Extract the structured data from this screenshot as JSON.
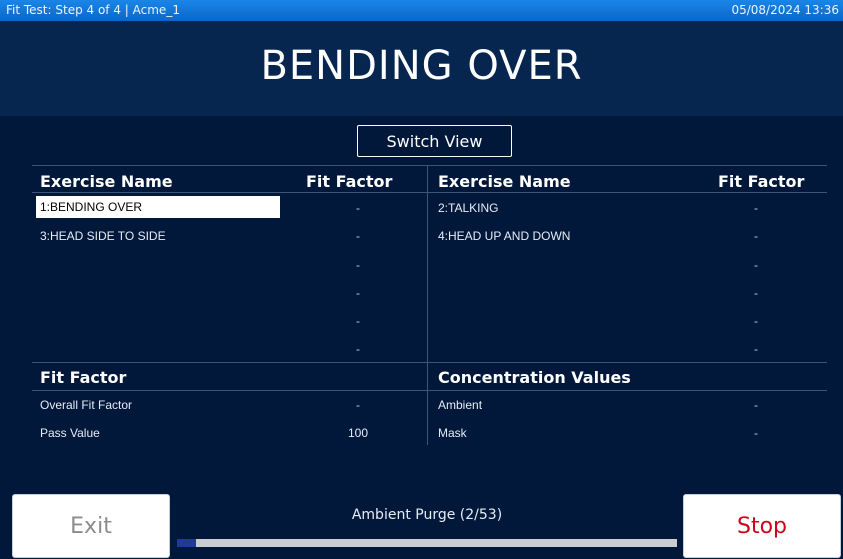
{
  "titlebar": {
    "left": "Fit Test: Step 4 of 4 | Acme_1",
    "right": "05/08/2024 13:36"
  },
  "header": {
    "title": "BENDING OVER"
  },
  "switch_view_label": "Switch View",
  "exercises": {
    "headers": {
      "name_left": "Exercise Name",
      "ff_left": "Fit Factor",
      "name_right": "Exercise Name",
      "ff_right": "Fit Factor"
    },
    "left_rows": [
      {
        "name": "1:BENDING OVER",
        "ff": "-"
      },
      {
        "name": "3:HEAD SIDE TO SIDE",
        "ff": "-"
      },
      {
        "name": "",
        "ff": "-"
      },
      {
        "name": "",
        "ff": "-"
      },
      {
        "name": "",
        "ff": "-"
      },
      {
        "name": "",
        "ff": "-"
      }
    ],
    "right_rows": [
      {
        "name": "2:TALKING",
        "ff": "-"
      },
      {
        "name": "4:HEAD UP AND DOWN",
        "ff": "-"
      },
      {
        "name": "",
        "ff": "-"
      },
      {
        "name": "",
        "ff": "-"
      },
      {
        "name": "",
        "ff": "-"
      },
      {
        "name": "",
        "ff": "-"
      }
    ]
  },
  "fit_factor": {
    "heading": "Fit Factor",
    "overall_label": "Overall Fit Factor",
    "overall_value": "-",
    "pass_label": "Pass Value",
    "pass_value": "100"
  },
  "concentration": {
    "heading": "Concentration Values",
    "ambient_label": "Ambient",
    "ambient_value": "-",
    "mask_label": "Mask",
    "mask_value": "-"
  },
  "footer": {
    "exit_label": "Exit",
    "stop_label": "Stop",
    "progress_label": "Ambient Purge (2/53)",
    "progress_fraction": 0.0377,
    "progress_color": "#1f3a9b",
    "stop_color": "#d0021b"
  }
}
